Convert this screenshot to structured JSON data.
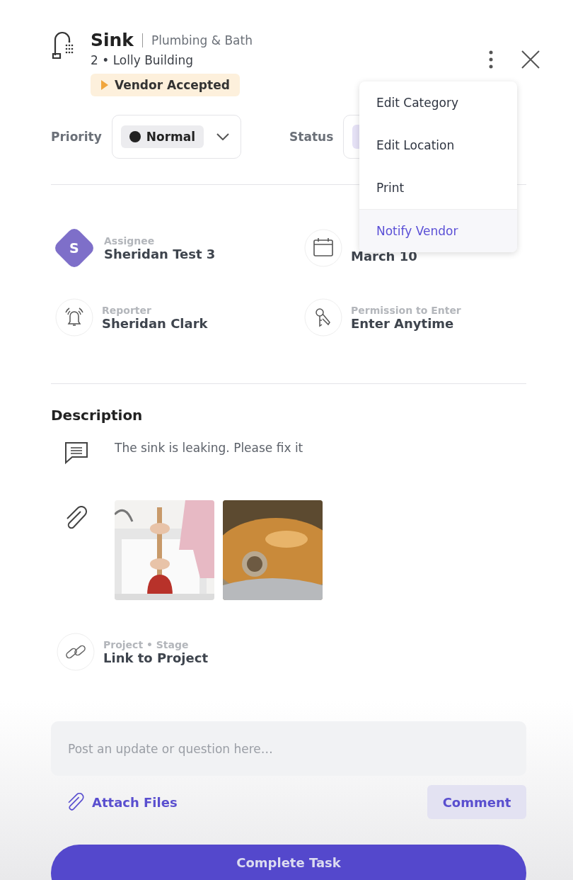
{
  "header": {
    "title": "Sink",
    "category": "Plumbing & Bath",
    "location": "2 • Lolly Building",
    "status_badge": "Vendor Accepted"
  },
  "priority": {
    "label": "Priority",
    "value": "Normal"
  },
  "status": {
    "label": "Status"
  },
  "menu": {
    "items": [
      {
        "label": "Edit Category",
        "selected": false
      },
      {
        "label": "Edit Location",
        "selected": false
      },
      {
        "label": "Print",
        "selected": false
      },
      {
        "label": "Notify Vendor",
        "selected": true
      }
    ]
  },
  "details": [
    {
      "kind": "avatar",
      "label": "Assignee",
      "value": "Sheridan Test 3",
      "initial": "S"
    },
    {
      "kind": "calendar",
      "value": "March 10"
    },
    {
      "kind": "bell",
      "label": "Reporter",
      "value": "Sheridan Clark"
    },
    {
      "kind": "keys",
      "label": "Permission to Enter",
      "value": "Enter Anytime"
    }
  ],
  "description": {
    "heading": "Description",
    "text": "The sink is leaking. Please fix it"
  },
  "project": {
    "label": "Project • Stage",
    "value": "Link to Project"
  },
  "comment": {
    "placeholder": "Post an update or question here…",
    "attach": "Attach Files",
    "button": "Comment"
  },
  "complete_button": "Complete Task"
}
